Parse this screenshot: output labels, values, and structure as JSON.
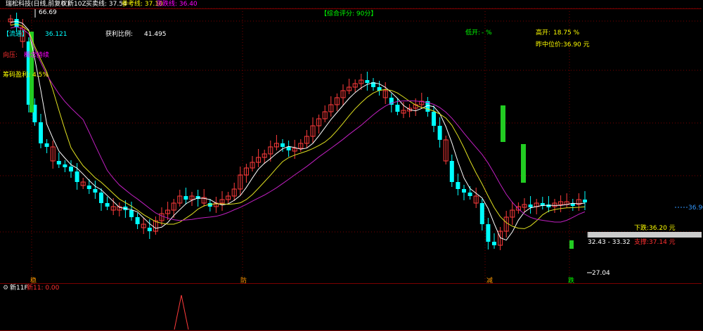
{
  "header": {
    "stock_name": "瑞松科技(日线,前复权)",
    "indicator_name": "新10Z",
    "buy_sell_label": "买卖线: 37.54",
    "ref_label": "参考线: 37.10",
    "drop_label": "涨跌线: 36.40"
  },
  "price_panel": {
    "score_text": "【综合评分: 90分】",
    "circulation_label": "【流通】",
    "circulation_value": "36.121",
    "profit_ratio_label": "获利比例:",
    "profit_ratio_value": "41.495",
    "low_open_label": "低开:",
    "low_open_value": "- %",
    "high_open_label": "高开:",
    "high_open_value": "18.75 %",
    "prev_mid_label": "昨中位价:",
    "prev_mid_value": "36.90 元",
    "pressure_text": "向压:",
    "pressure_value": "概念持续",
    "chip_profit_label": "筹码盈利:",
    "chip_profit_value": "4.5%",
    "high_marker": "66.69",
    "low_marker": "27.04",
    "range_marker": "32.43 - 33.32",
    "right_price": "36.90",
    "down_label": "下跌:36.20 元",
    "stop_label": "支撑:37.14 元",
    "signal_1": "稳",
    "signal_2": "防",
    "signal_3": "减",
    "signal_4": "跌"
  },
  "sub_panel": {
    "name": "新11F",
    "value_label": "新11: 0.00"
  },
  "colors": {
    "up": "#ff3b3b",
    "down": "#00ffff",
    "green_bar": "#22cc22",
    "ma_white": "#ffffff",
    "ma_yellow": "#e0e020",
    "ma_purple": "#c020c0",
    "grid": "#7a0000",
    "label_yellow": "#ffff00",
    "label_magenta": "#ff00ff",
    "label_green": "#00ff00",
    "label_cyan": "#00ffff",
    "label_red": "#ff3030"
  }
}
